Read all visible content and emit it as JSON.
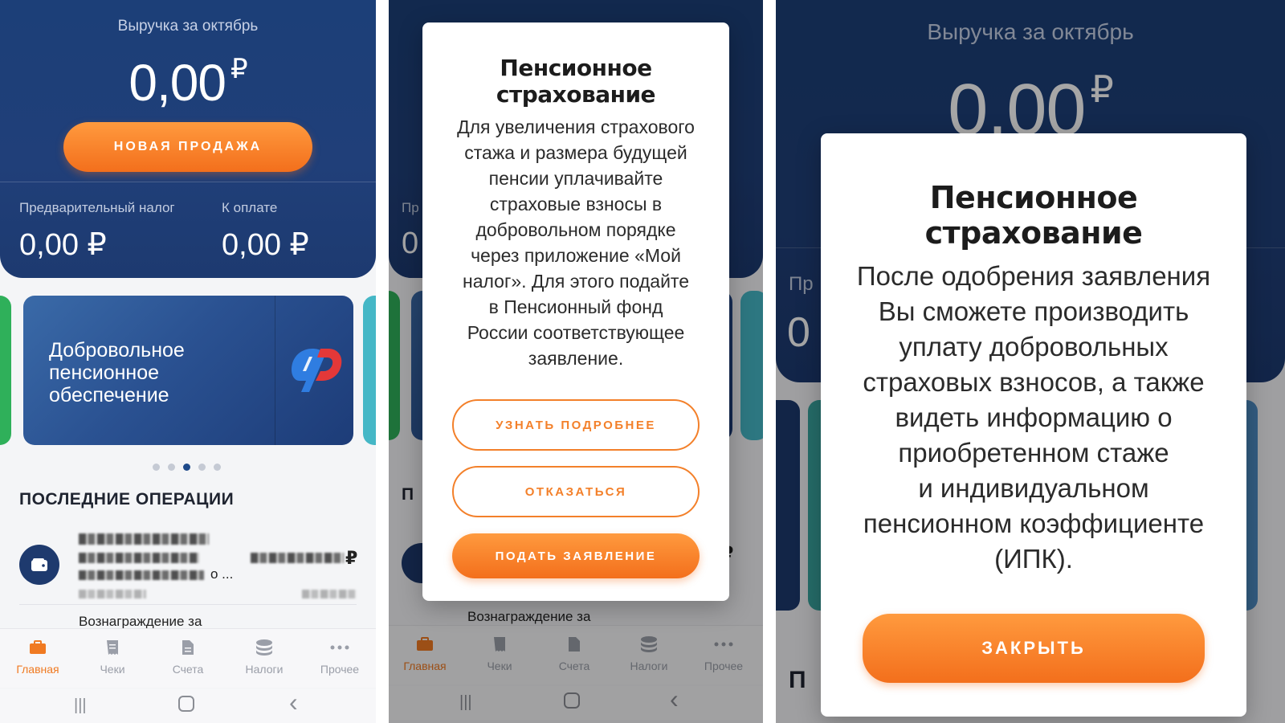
{
  "screen1": {
    "hero_title": "Выручка за октябрь",
    "amount": "0,00",
    "currency": "₽",
    "new_sale": "НОВАЯ ПРОДАЖА",
    "prelim_tax_label": "Предварительный налог",
    "prelim_tax_value": "0,00 ₽",
    "to_pay_label": "К оплате",
    "to_pay_value": "0,00 ₽",
    "card_text_1": "Добровольное",
    "card_text_2": "пенсионное",
    "card_text_3": "обеспечение",
    "carousel_active_index": 3,
    "carousel_count": 5,
    "recent_title": "ПОСЛЕДНИЕ ОПЕРАЦИИ",
    "op_suffix": "о ...",
    "op_currency": "₽",
    "op_next": "Вознаграждение за"
  },
  "tabs": [
    {
      "label": "Главная",
      "icon": "briefcase-icon"
    },
    {
      "label": "Чеки",
      "icon": "receipt-icon"
    },
    {
      "label": "Счета",
      "icon": "document-icon"
    },
    {
      "label": "Налоги",
      "icon": "coins-icon"
    },
    {
      "label": "Прочее",
      "icon": "more-icon"
    }
  ],
  "system_nav": {
    "recents": "|||",
    "home": "◯",
    "back": "‹"
  },
  "screen2": {
    "modal_title": "Пенсионное страхование",
    "body": [
      "Для увеличения страхового",
      "стажа и размера будущей",
      "пенсии уплачивайте",
      "страховые взносы в",
      "добровольном порядке",
      "через приложение «Мой",
      "налог». Для этого подайте",
      "в Пенсионный фонд",
      "России соответствующее",
      "заявление."
    ],
    "learn_more": "УЗНАТЬ ПОДРОБНЕЕ",
    "decline": "ОТКАЗАТЬСЯ",
    "apply": "ПОДАТЬ ЗАЯВЛЕНИЕ",
    "bg_partial_left": "Пр",
    "bg_partial_zero": "0",
    "bg_partial_section": "П",
    "bg_op_next": "Вознаграждение за",
    "bg_rub": "₽",
    "bg_rub_small": "₽"
  },
  "screen3": {
    "hero_title": "Выручка за октябрь",
    "amount": "0,00",
    "currency": "₽",
    "modal_title": "Пенсионное страхование",
    "body": [
      "После одобрения заявления",
      "Вы сможете производить",
      "уплату добровольных",
      "страховых взносов, а также",
      "видеть информацию о",
      "приобретенном стаже",
      "и индивидуальном",
      "пенсионном коэффициенте",
      "(ИПК)."
    ],
    "close": "ЗАКРЫТЬ",
    "bg_partial_left": "Пр",
    "bg_partial_zero": "0",
    "bg_partial_section": "П"
  },
  "colors": {
    "brand_blue": "#1f3f78",
    "accent_orange": "#f3802a",
    "tab_active": "#f07a22"
  }
}
